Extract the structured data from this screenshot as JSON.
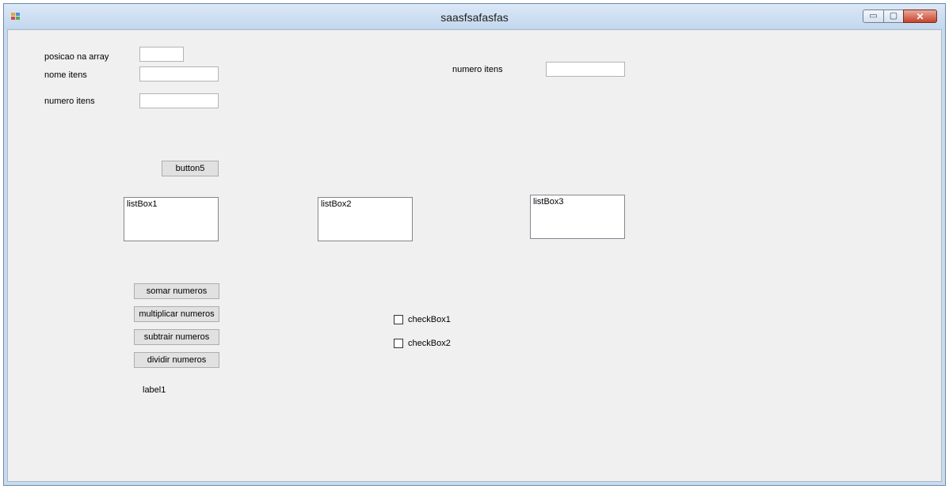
{
  "window": {
    "title": "saasfsafasfas",
    "controls": {
      "minimize": "▭",
      "maximize": "▢",
      "close": "✕"
    }
  },
  "form": {
    "left": {
      "posicao_label": "posicao na array",
      "nome_label": "nome itens",
      "numero_label": "numero itens",
      "posicao_value": "",
      "nome_value": "",
      "numero_value": ""
    },
    "right": {
      "numero_label": "numero itens",
      "numero_value": ""
    },
    "button5_label": "button5",
    "listboxes": [
      "listBox1",
      "listBox2",
      "listBox3"
    ],
    "operations": [
      "somar numeros",
      "multiplicar  numeros",
      "subtrair numeros",
      "dividir numeros"
    ],
    "label1": "label1",
    "checkboxes": [
      {
        "label": "checkBox1",
        "checked": false
      },
      {
        "label": "checkBox2",
        "checked": false
      }
    ]
  }
}
